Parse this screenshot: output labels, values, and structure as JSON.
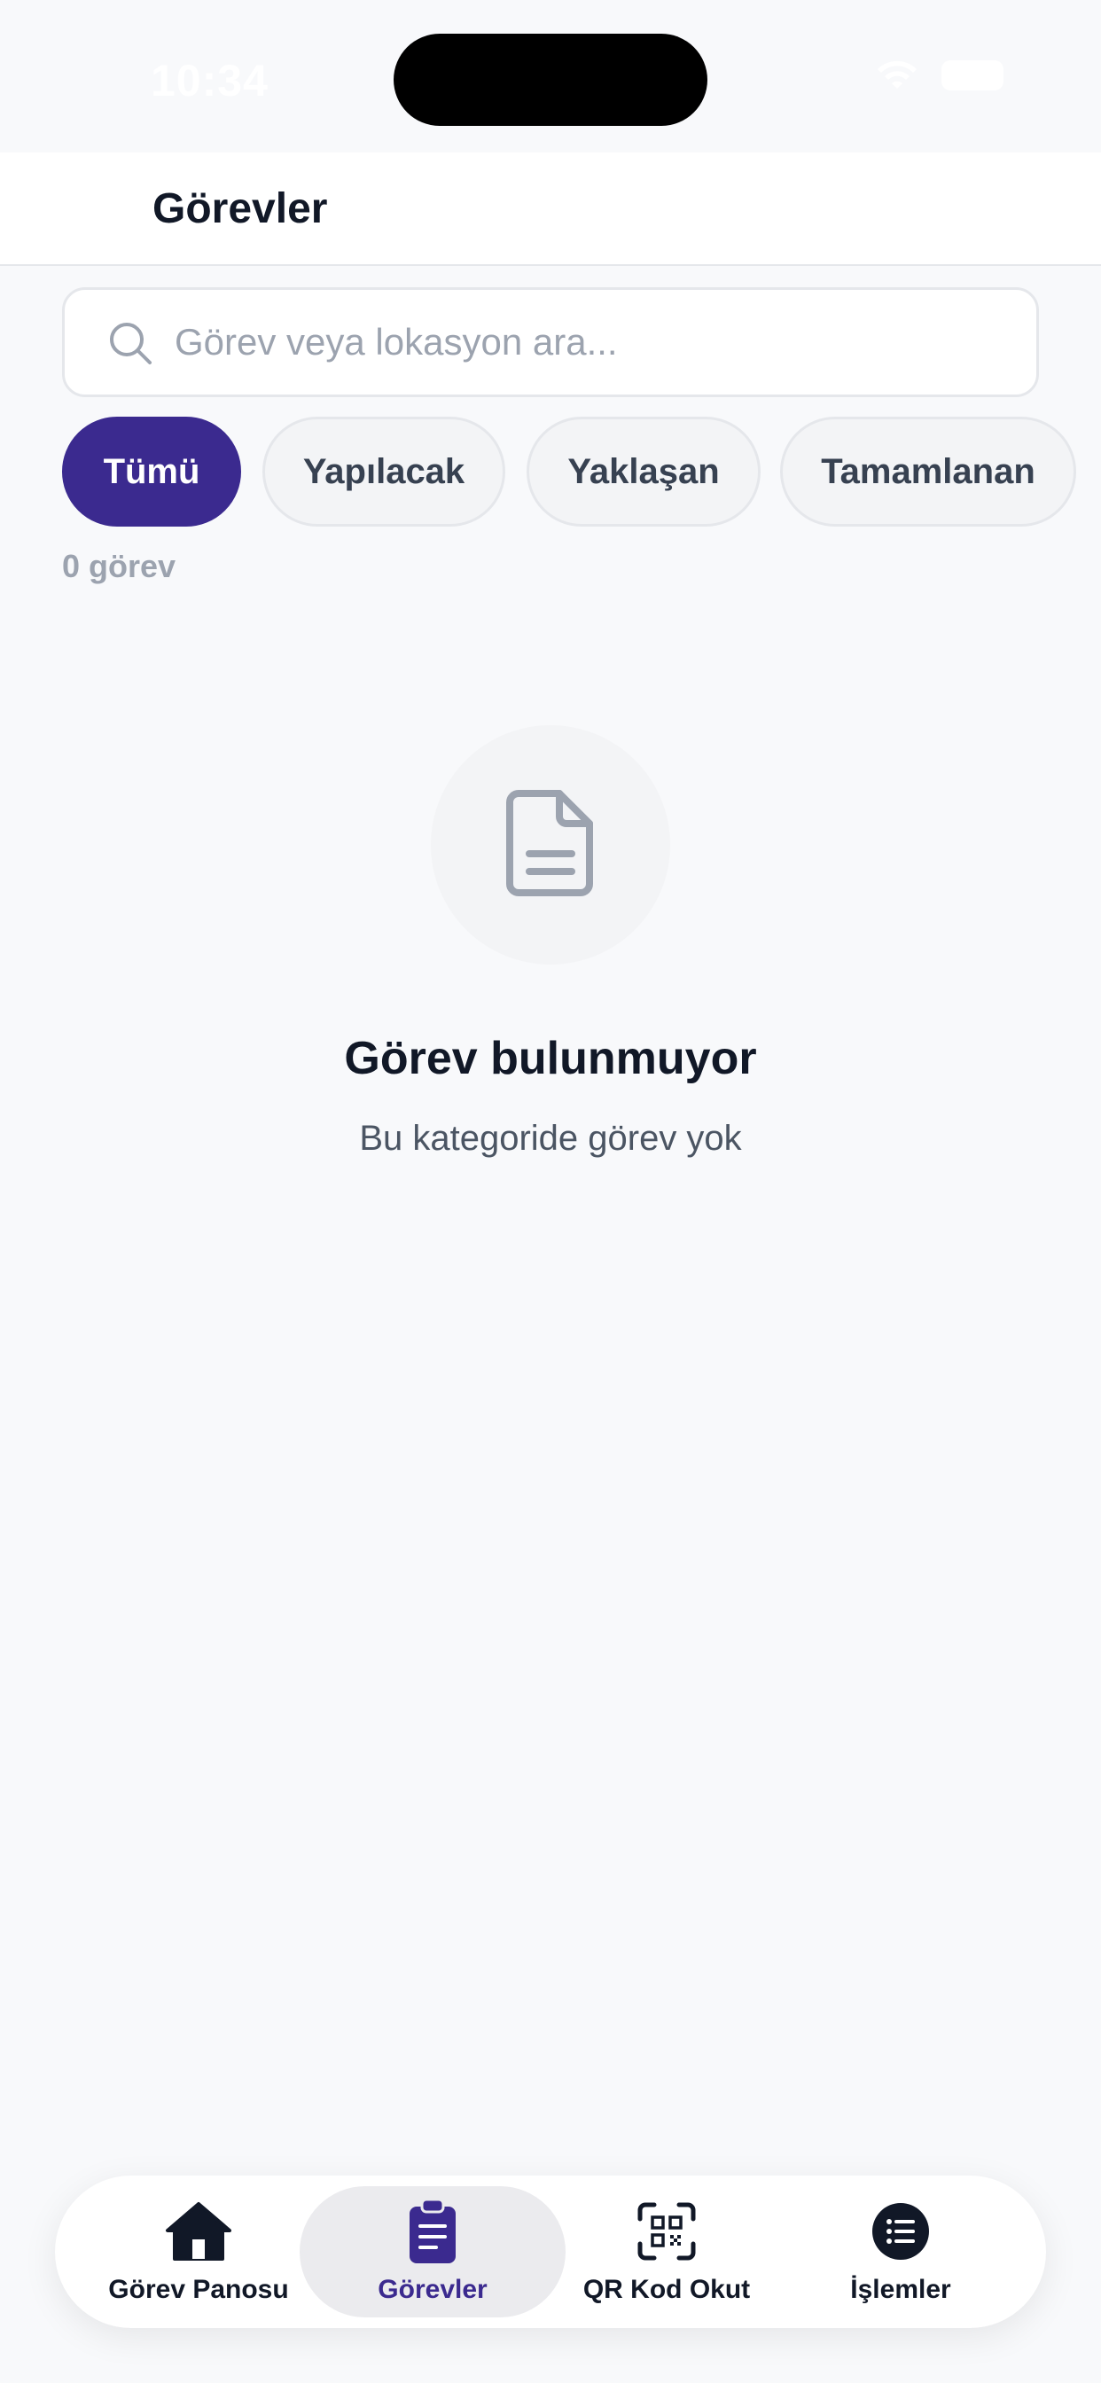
{
  "status_bar": {
    "time": "10:34"
  },
  "header": {
    "title": "Görevler"
  },
  "search": {
    "placeholder": "Görev veya lokasyon ara...",
    "value": ""
  },
  "filters": [
    {
      "label": "Tümü",
      "active": true
    },
    {
      "label": "Yapılacak",
      "active": false
    },
    {
      "label": "Yaklaşan",
      "active": false
    },
    {
      "label": "Tamamlanan",
      "active": false
    }
  ],
  "task_count": "0 görev",
  "empty_state": {
    "icon": "document-icon",
    "title": "Görev bulunmuyor",
    "subtitle": "Bu kategoride görev yok"
  },
  "tab_bar": {
    "tabs": [
      {
        "label": "Görev Panosu",
        "icon": "home-icon",
        "active": false
      },
      {
        "label": "Görevler",
        "icon": "clipboard-icon",
        "active": true
      },
      {
        "label": "QR Kod Okut",
        "icon": "qr-scan-icon",
        "active": false
      },
      {
        "label": "İşlemler",
        "icon": "list-icon",
        "active": false
      }
    ]
  },
  "colors": {
    "accent": "#3b2a8f",
    "background": "#f8f9fb",
    "chip_inactive": "#f3f4f6",
    "muted_text": "#9ca3af"
  }
}
